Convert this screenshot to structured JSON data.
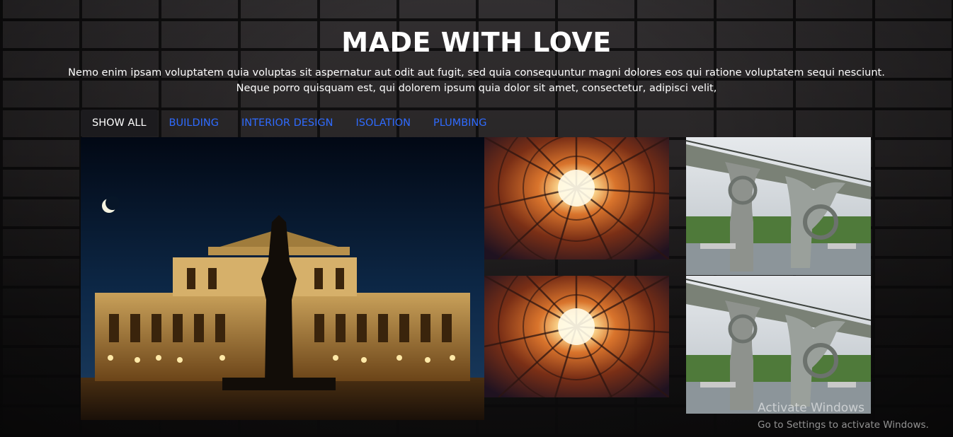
{
  "header": {
    "title": "MADE WITH LOVE",
    "description_line1": "Nemo enim ipsam voluptatem quia voluptas sit aspernatur aut odit aut fugit, sed quia consequuntur magni dolores eos qui ratione voluptatem sequi nesciunt.",
    "description_line2": "Neque porro quisquam est, qui dolorem ipsum quia dolor sit amet, consectetur, adipisci velit,"
  },
  "tabs": [
    {
      "label": "SHOW ALL",
      "active": true
    },
    {
      "label": "BUILDING",
      "active": false
    },
    {
      "label": "INTERIOR DESIGN",
      "active": false
    },
    {
      "label": "ISOLATION",
      "active": false
    },
    {
      "label": "PLUMBING",
      "active": false
    }
  ],
  "gallery": {
    "images": [
      {
        "subject": "opera-house-night-photo"
      },
      {
        "subject": "courtyard-looking-up-photo"
      },
      {
        "subject": "wheel-bridge-photo"
      },
      {
        "subject": "courtyard-looking-up-photo"
      },
      {
        "subject": "wheel-bridge-photo"
      }
    ]
  },
  "colors": {
    "tab_link": "#2f6bff",
    "tab_active_bg": "#1c1b1e",
    "text": "#ffffff"
  },
  "watermark": {
    "title": "Activate Windows",
    "subtitle": "Go to Settings to activate Windows."
  }
}
